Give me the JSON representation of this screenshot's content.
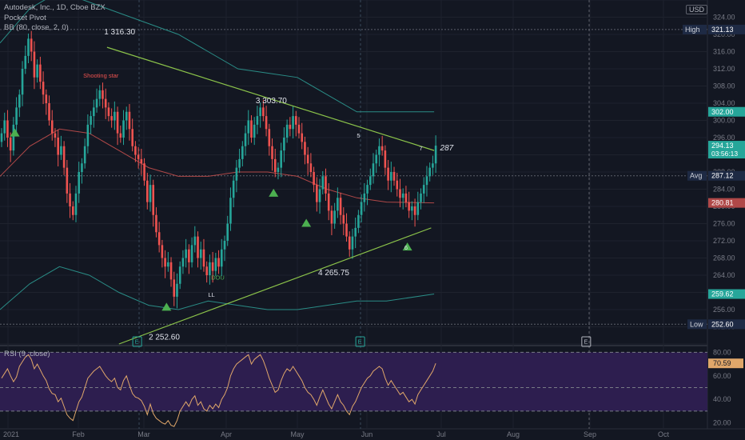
{
  "header": {
    "symbol_line": "Autodesk, Inc., 1D, Cboe BZX",
    "indicator1": "Pocket Pivot",
    "indicator2": "BB (80, close, 2, 0)",
    "currency": "USD",
    "rsi_label": "RSI (9, close)"
  },
  "colors": {
    "background": "#131722",
    "up": "#26a69a",
    "down": "#ef5350",
    "trendline": "#8bc34a",
    "bb_band": "#2a8c86",
    "bb_mid": "#b04848",
    "rsi_line": "#e0a76a",
    "rsi_fill": "#2d1e4f",
    "pivot_marker": "#4caf50"
  },
  "chart_data": [
    {
      "type": "candlestick",
      "title": "Autodesk, Inc., 1D, Cboe BZX",
      "ylim": [
        248,
        328
      ],
      "y_ticks": [
        248,
        252,
        256,
        260,
        264,
        268,
        272,
        276,
        280,
        284,
        288,
        292,
        296,
        300,
        304,
        308,
        312,
        316,
        320,
        324,
        328
      ],
      "x_ticks": [
        "2021",
        "Feb",
        "Mar",
        "Apr",
        "May",
        "Jun",
        "Jul",
        "Aug",
        "Sep",
        "Oct"
      ],
      "price_labels": [
        {
          "tag": "High",
          "value": "321.13",
          "color": "#1e2a44"
        },
        {
          "tag": "",
          "value": "302.00",
          "color": "#26a69a"
        },
        {
          "tag": "",
          "value": "294.13",
          "sub": "03:56:13",
          "color": "#26a69a"
        },
        {
          "tag": "Avg",
          "value": "287.12",
          "color": "#1e2a44"
        },
        {
          "tag": "",
          "value": "280.81",
          "color": "#b04848"
        },
        {
          "tag": "",
          "value": "259.62",
          "color": "#26a69a"
        },
        {
          "tag": "Low",
          "value": "252.60",
          "color": "#1e2a44"
        }
      ],
      "closes": [
        297,
        300,
        296,
        293,
        299,
        303,
        306,
        312,
        315,
        319,
        316,
        310,
        313,
        309,
        306,
        304,
        300,
        297,
        296,
        292,
        294,
        289,
        283,
        280,
        278,
        283,
        288,
        290,
        294,
        299,
        301,
        303,
        305,
        307,
        305,
        303,
        301,
        300,
        302,
        297,
        296,
        300,
        302,
        298,
        294,
        292,
        291,
        290,
        286,
        281,
        285,
        278,
        274,
        271,
        268,
        266,
        267,
        263,
        259,
        262,
        266,
        268,
        270,
        267,
        271,
        273,
        268,
        270,
        266,
        264,
        267,
        265,
        268,
        266,
        270,
        272,
        276,
        282,
        286,
        289,
        291,
        294,
        297,
        300,
        296,
        299,
        301,
        303,
        301,
        298,
        294,
        291,
        288,
        289,
        293,
        296,
        299,
        298,
        301,
        299,
        297,
        295,
        292,
        290,
        288,
        285,
        281,
        284,
        287,
        283,
        279,
        276,
        279,
        282,
        278,
        276,
        273,
        270,
        273,
        275,
        278,
        281,
        283,
        285,
        287,
        290,
        292,
        294,
        293,
        289,
        286,
        288,
        286,
        284,
        282,
        283,
        281,
        279,
        280,
        278,
        281,
        283,
        285,
        287,
        289,
        290,
        294.13
      ],
      "bb_upper": [
        {
          "x": 0,
          "y": 318
        },
        {
          "x": 5,
          "y": 322
        },
        {
          "x": 10,
          "y": 326
        },
        {
          "x": 20,
          "y": 330
        },
        {
          "x": 40,
          "y": 325
        },
        {
          "x": 60,
          "y": 320
        },
        {
          "x": 70,
          "y": 316
        },
        {
          "x": 80,
          "y": 312
        },
        {
          "x": 90,
          "y": 311
        },
        {
          "x": 100,
          "y": 310
        },
        {
          "x": 110,
          "y": 306
        },
        {
          "x": 120,
          "y": 302
        },
        {
          "x": 130,
          "y": 302
        },
        {
          "x": 146,
          "y": 302.0
        }
      ],
      "bb_lower": [
        {
          "x": 0,
          "y": 256
        },
        {
          "x": 10,
          "y": 262
        },
        {
          "x": 20,
          "y": 266
        },
        {
          "x": 30,
          "y": 264
        },
        {
          "x": 40,
          "y": 260
        },
        {
          "x": 50,
          "y": 257
        },
        {
          "x": 60,
          "y": 256
        },
        {
          "x": 70,
          "y": 258
        },
        {
          "x": 80,
          "y": 257
        },
        {
          "x": 90,
          "y": 256
        },
        {
          "x": 100,
          "y": 256
        },
        {
          "x": 110,
          "y": 257
        },
        {
          "x": 120,
          "y": 258
        },
        {
          "x": 130,
          "y": 258
        },
        {
          "x": 146,
          "y": 259.62
        }
      ],
      "bb_mid": [
        {
          "x": 0,
          "y": 287
        },
        {
          "x": 10,
          "y": 294
        },
        {
          "x": 20,
          "y": 298
        },
        {
          "x": 30,
          "y": 297
        },
        {
          "x": 40,
          "y": 293
        },
        {
          "x": 50,
          "y": 289
        },
        {
          "x": 60,
          "y": 287
        },
        {
          "x": 70,
          "y": 287
        },
        {
          "x": 80,
          "y": 288
        },
        {
          "x": 90,
          "y": 288
        },
        {
          "x": 100,
          "y": 287
        },
        {
          "x": 110,
          "y": 284
        },
        {
          "x": 120,
          "y": 282
        },
        {
          "x": 130,
          "y": 281
        },
        {
          "x": 146,
          "y": 280.81
        }
      ],
      "trendlines": [
        {
          "from": {
            "x": 36,
            "y": 317
          },
          "to": {
            "x": 146,
            "y": 293
          }
        },
        {
          "from": {
            "x": 40,
            "y": 248
          },
          "to": {
            "x": 145,
            "y": 275
          }
        }
      ],
      "annotations": [
        {
          "text": "1  316.30",
          "x": 35,
          "y": 320
        },
        {
          "text": "Shooting star",
          "x": 28,
          "y": 310
        },
        {
          "text": "3  303.70",
          "x": 86,
          "y": 304
        },
        {
          "text": "4  265.75",
          "x": 107,
          "y": 264
        },
        {
          "text": "2  252.60",
          "x": 50,
          "y": 249
        },
        {
          "text": "5",
          "x": 120,
          "y": 296
        },
        {
          "text": "6",
          "x": 136,
          "y": 270
        },
        {
          "text": "7",
          "x": 141,
          "y": 293
        },
        {
          "text": "287",
          "x": 148,
          "y": 293
        },
        {
          "text": "DOU",
          "x": 71,
          "y": 263
        },
        {
          "text": "LL",
          "x": 70,
          "y": 259
        },
        {
          "text": "E",
          "x": 46,
          "y": 248
        },
        {
          "text": "E",
          "x": 121,
          "y": 248
        },
        {
          "text": "E",
          "x": 197,
          "y": 248
        }
      ],
      "pivot_markers": [
        {
          "x": 5,
          "y": 297
        },
        {
          "x": 56,
          "y": 256.5
        },
        {
          "x": 92,
          "y": 283
        },
        {
          "x": 103,
          "y": 276
        },
        {
          "x": 137,
          "y": 270.5
        }
      ]
    },
    {
      "type": "line",
      "title": "RSI (9, close)",
      "ylim": [
        15,
        85
      ],
      "y_ticks": [
        20,
        40,
        60,
        80
      ],
      "bands": [
        30,
        80
      ],
      "last_value": "70.59",
      "values": [
        58,
        62,
        66,
        60,
        55,
        59,
        68,
        72,
        76,
        78,
        74,
        66,
        70,
        65,
        60,
        56,
        49,
        45,
        44,
        38,
        41,
        34,
        27,
        24,
        22,
        30,
        38,
        42,
        50,
        58,
        61,
        64,
        66,
        68,
        64,
        60,
        57,
        55,
        58,
        50,
        48,
        56,
        60,
        52,
        45,
        42,
        41,
        39,
        34,
        27,
        36,
        28,
        24,
        22,
        20,
        19,
        22,
        18,
        17,
        22,
        30,
        34,
        38,
        34,
        40,
        43,
        35,
        38,
        32,
        30,
        35,
        32,
        36,
        33,
        40,
        44,
        50,
        60,
        66,
        70,
        72,
        74,
        76,
        78,
        70,
        74,
        76,
        78,
        73,
        66,
        58,
        52,
        46,
        48,
        56,
        62,
        66,
        64,
        68,
        64,
        60,
        56,
        50,
        46,
        44,
        40,
        35,
        42,
        48,
        42,
        36,
        32,
        38,
        44,
        38,
        35,
        30,
        27,
        34,
        38,
        44,
        50,
        54,
        58,
        60,
        64,
        66,
        68,
        66,
        58,
        52,
        56,
        52,
        48,
        44,
        46,
        42,
        38,
        40,
        36,
        44,
        48,
        52,
        56,
        60,
        64,
        70.59
      ]
    }
  ]
}
